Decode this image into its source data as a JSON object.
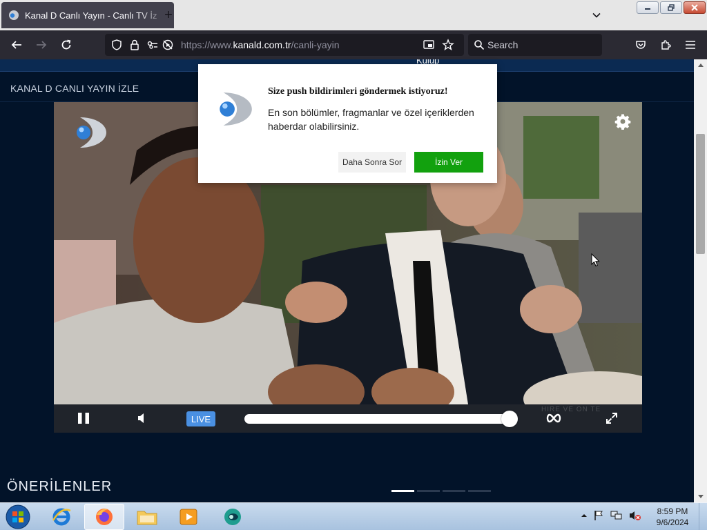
{
  "browser": {
    "tab": {
      "title": "Kanal D Canlı Yayın - Canlı TV İz"
    },
    "url": {
      "prefix": "https://www.",
      "host": "kanald.com.tr",
      "path": "/canli-yayin"
    },
    "search": {
      "placeholder": "Search"
    }
  },
  "page": {
    "topstrip_text": "Kulüp",
    "section_title": "KANAL D CANLI YAYIN İZLE",
    "player": {
      "live_label": "LIVE",
      "watermark": "HIRE VE ON TE",
      "progress": 0.96
    },
    "recommended_title": "ÖNERİLENLER",
    "carousel": {
      "count": 4,
      "active": 0
    }
  },
  "popup": {
    "title": "Size push bildirimleri göndermek istiyoruz!",
    "body": "En son bölümler, fragmanlar ve özel içeriklerden haberdar olabilirsiniz.",
    "later_label": "Daha Sonra Sor",
    "allow_label": "İzin Ver"
  },
  "taskbar": {
    "time": "8:59 PM",
    "date": "9/6/2024"
  },
  "colors": {
    "page_bg": "#021329",
    "live_badge": "#4a90e2",
    "allow_button": "#12a10e",
    "browser_toolbar": "#2b2a33"
  }
}
